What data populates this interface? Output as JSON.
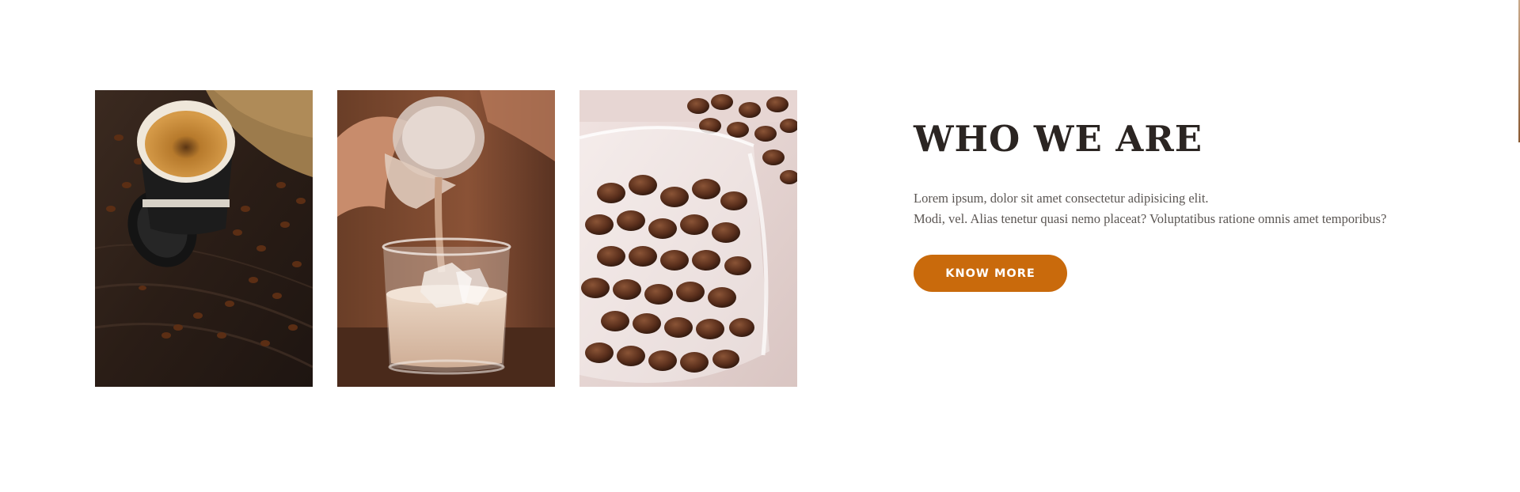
{
  "gallery": {
    "images": [
      {
        "alt": "Espresso cup on coffee beans",
        "icon": "coffee-cup-photo"
      },
      {
        "alt": "Milk pouring into iced coffee",
        "icon": "iced-latte-photo"
      },
      {
        "alt": "Coffee beans in a glass jar",
        "icon": "coffee-beans-jar-photo"
      }
    ]
  },
  "about": {
    "title": "WHO WE ARE",
    "text_line1": "Lorem ipsum, dolor sit amet consectetur adipisicing elit.",
    "text_line2": "Modi, vel. Alias tenetur quasi nemo placeat? Voluptatibus ratione omnis amet temporibus?",
    "button_label": "KNOW MORE"
  },
  "colors": {
    "accent": "#c96a0c",
    "heading": "#2b2522",
    "body_text": "#5b5653",
    "background": "#ffffff"
  }
}
